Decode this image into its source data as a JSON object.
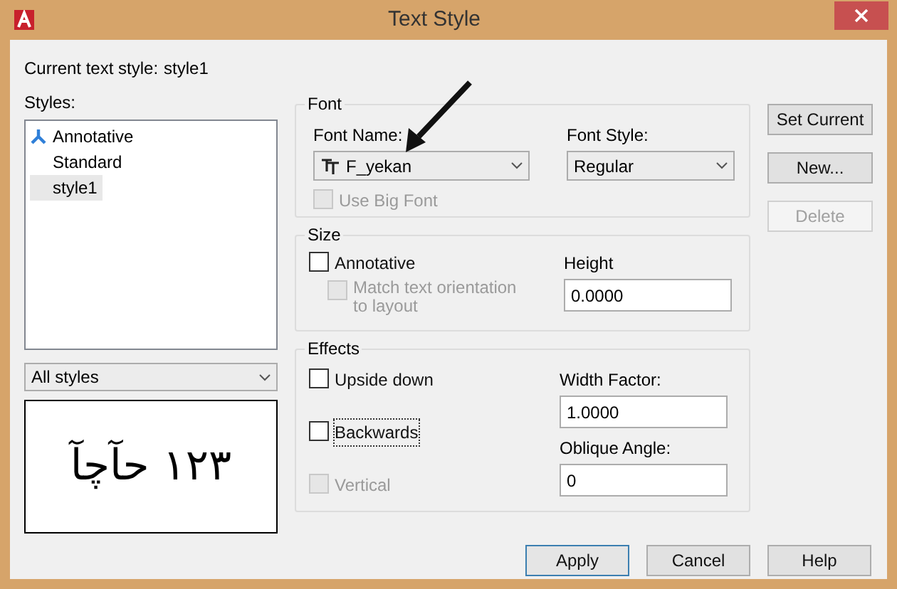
{
  "window": {
    "title": "Text Style"
  },
  "current_style": {
    "label": "Current text style:",
    "value": "style1"
  },
  "styles": {
    "label": "Styles:",
    "items": [
      {
        "name": "Annotative",
        "kind": "annotative",
        "selected": false
      },
      {
        "name": "Standard",
        "kind": "plain",
        "selected": false
      },
      {
        "name": "style1",
        "kind": "plain",
        "selected": true
      }
    ]
  },
  "filter": {
    "value": "All styles"
  },
  "preview": {
    "text": "آچآح ۱۲۳"
  },
  "font": {
    "title": "Font",
    "font_name": {
      "label": "Font Name:",
      "value": "F_yekan"
    },
    "font_style": {
      "label": "Font Style:",
      "value": "Regular"
    },
    "use_big_font": {
      "label": "Use Big Font",
      "checked": false,
      "disabled": true
    }
  },
  "size": {
    "title": "Size",
    "annotative": {
      "label": "Annotative",
      "checked": false,
      "disabled": false
    },
    "match_orientation": {
      "label": "Match text orientation to layout",
      "checked": false,
      "disabled": true
    },
    "height": {
      "label": "Height",
      "value": "0.0000"
    }
  },
  "effects": {
    "title": "Effects",
    "checkboxes": [
      {
        "label": "Upside down",
        "checked": false,
        "disabled": false,
        "focused": false
      },
      {
        "label": "Backwards",
        "checked": false,
        "disabled": false,
        "focused": true
      },
      {
        "label": "Vertical",
        "checked": false,
        "disabled": true,
        "focused": false
      }
    ],
    "width_factor": {
      "label": "Width Factor:",
      "value": "1.0000"
    },
    "oblique_angle": {
      "label": "Oblique Angle:",
      "value": "0"
    }
  },
  "side_buttons": [
    {
      "label": "Set Current",
      "disabled": false
    },
    {
      "label": "New...",
      "disabled": false
    },
    {
      "label": "Delete",
      "disabled": true
    }
  ],
  "buttons": [
    {
      "label": "Apply",
      "default": true
    },
    {
      "label": "Cancel",
      "default": false
    },
    {
      "label": "Help",
      "default": false
    }
  ]
}
